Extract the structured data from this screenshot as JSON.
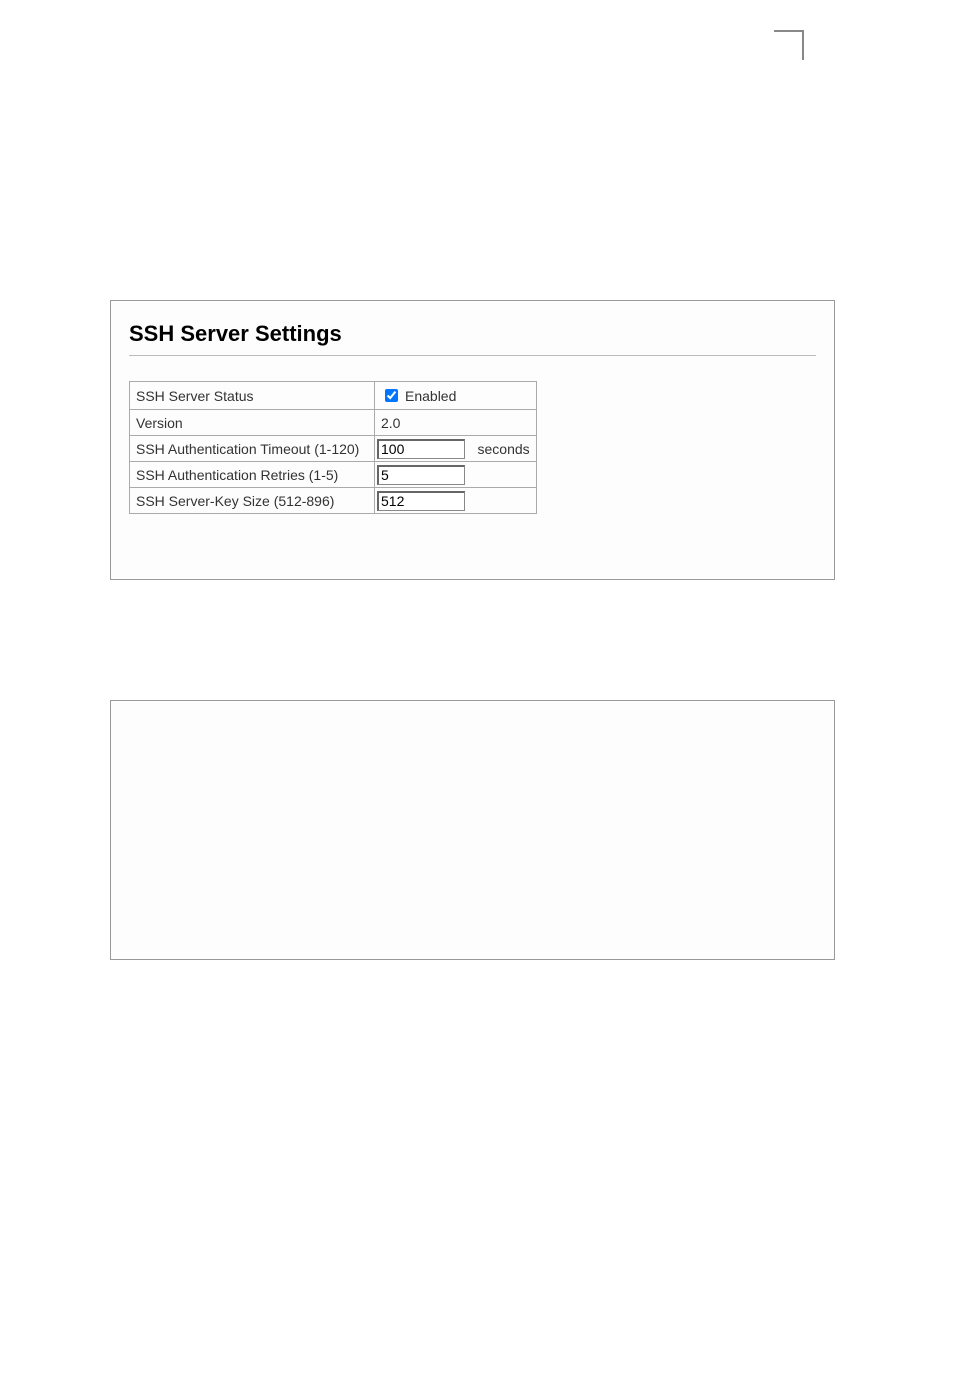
{
  "title": "SSH Server Settings",
  "rows": {
    "status": {
      "label": "SSH Server Status",
      "checkbox_label": "Enabled",
      "checked": true
    },
    "version": {
      "label": "Version",
      "value": "2.0"
    },
    "timeout": {
      "label": "SSH Authentication Timeout (1-120)",
      "value": "100",
      "unit": "seconds"
    },
    "retries": {
      "label": "SSH Authentication Retries (1-5)",
      "value": "5"
    },
    "keysize": {
      "label": "SSH Server-Key Size (512-896)",
      "value": "512"
    }
  }
}
